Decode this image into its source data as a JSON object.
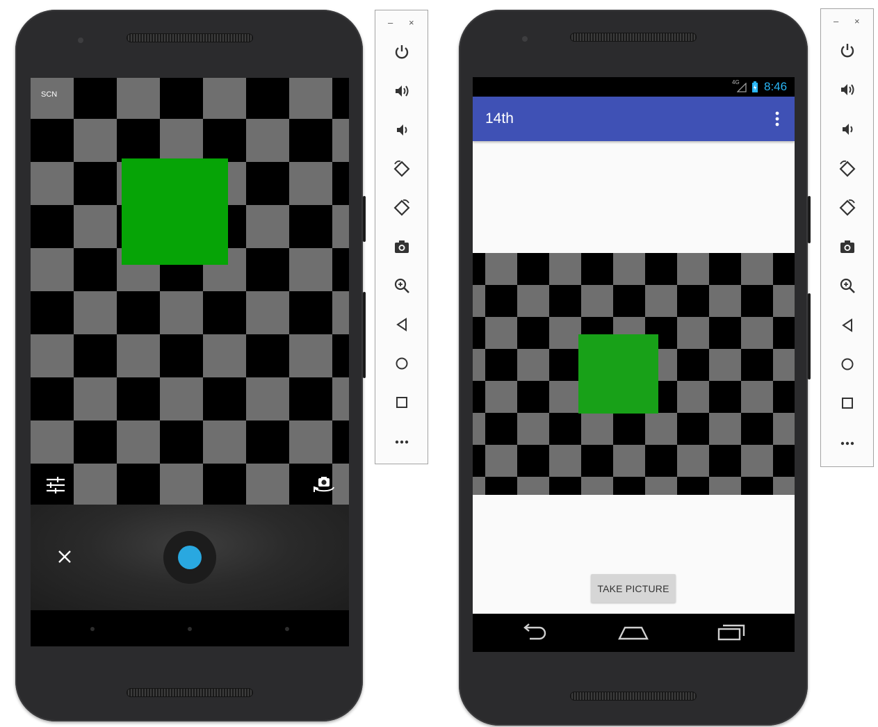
{
  "left_device": {
    "camera_app": {
      "mode_label": "SCN",
      "settings_icon": "sliders-icon",
      "switch_camera_icon": "switch-camera-icon",
      "cancel_icon": "close-icon",
      "shutter_icon": "shutter-button-icon"
    },
    "nav_icons": [
      "dot-icon",
      "dot-icon",
      "dot-icon"
    ]
  },
  "right_device": {
    "status_bar": {
      "network": "4G",
      "time": "8:46",
      "time_color": "#29b6f6"
    },
    "app_bar": {
      "title": "14th",
      "menu_icon": "overflow-menu-icon",
      "color": "#3f51b5"
    },
    "take_picture_button": "TAKE PICTURE",
    "nav_icons": [
      "back-icon",
      "home-icon",
      "recents-icon"
    ]
  },
  "emulator_toolbar": {
    "minimize_label": "–",
    "close_label": "×",
    "tools": [
      {
        "name": "power-icon"
      },
      {
        "name": "volume-up-icon"
      },
      {
        "name": "volume-down-icon"
      },
      {
        "name": "rotate-left-icon"
      },
      {
        "name": "rotate-right-icon"
      },
      {
        "name": "screenshot-icon"
      },
      {
        "name": "zoom-icon"
      },
      {
        "name": "back-icon"
      },
      {
        "name": "home-icon"
      },
      {
        "name": "overview-icon"
      },
      {
        "name": "more-icon"
      }
    ]
  },
  "colors": {
    "checker_dark": "#000000",
    "checker_light": "#6f6f6f",
    "target_square": "#08a308",
    "shutter_accent": "#29a8e0"
  }
}
